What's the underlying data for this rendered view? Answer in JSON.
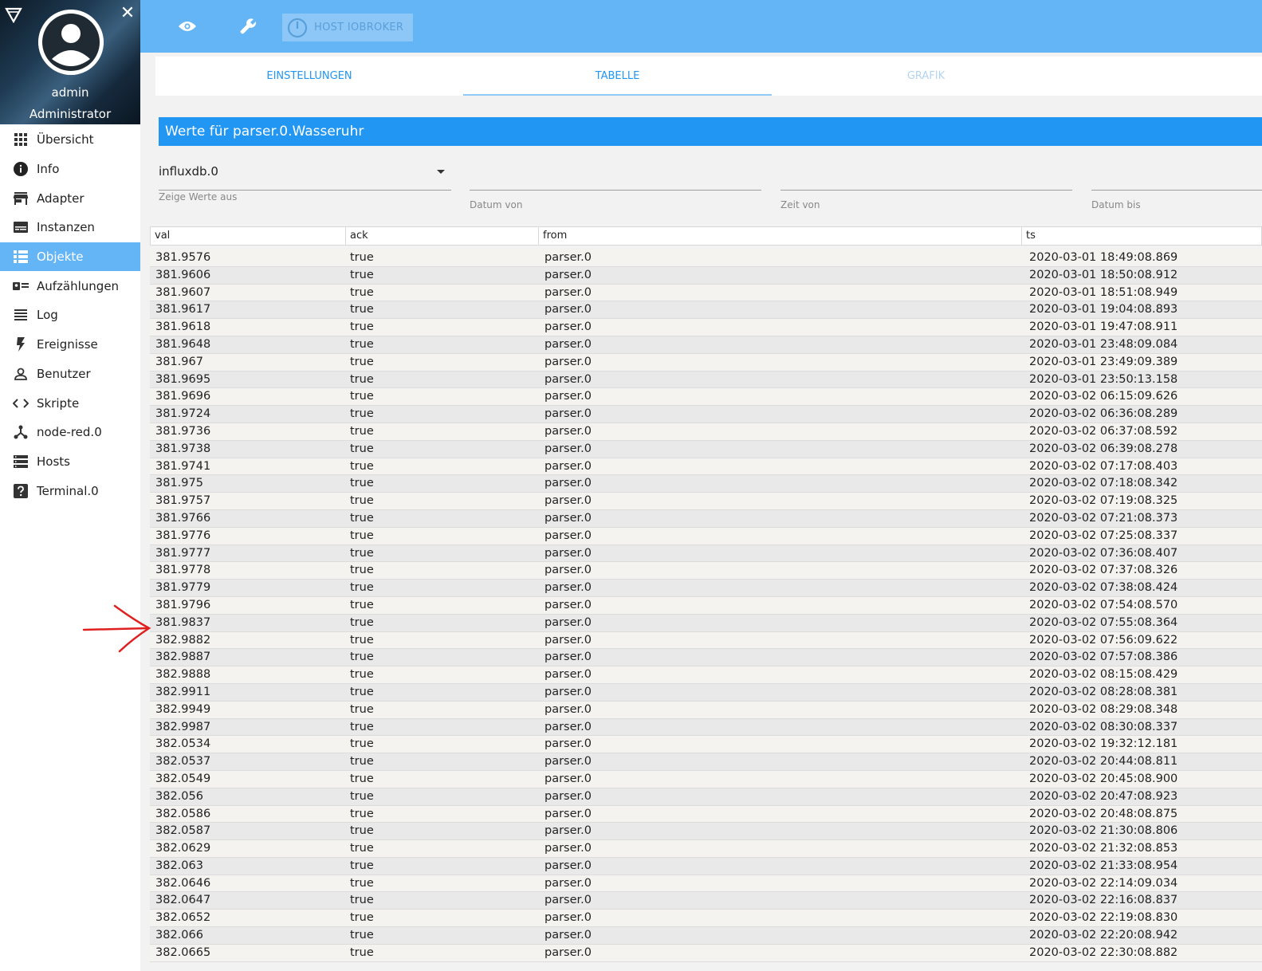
{
  "sidebar": {
    "user": {
      "name": "admin",
      "role": "Administrator"
    },
    "items": [
      {
        "label": "Übersicht",
        "icon": "apps-grid-icon",
        "active": false
      },
      {
        "label": "Info",
        "icon": "info-icon",
        "active": false
      },
      {
        "label": "Adapter",
        "icon": "store-icon",
        "active": false
      },
      {
        "label": "Instanzen",
        "icon": "instances-icon",
        "active": false
      },
      {
        "label": "Objekte",
        "icon": "list-icon",
        "active": true
      },
      {
        "label": "Aufzählungen",
        "icon": "enum-icon",
        "active": false
      },
      {
        "label": "Log",
        "icon": "log-lines-icon",
        "active": false
      },
      {
        "label": "Ereignisse",
        "icon": "lightning-icon",
        "active": false
      },
      {
        "label": "Benutzer",
        "icon": "user-icon",
        "active": false
      },
      {
        "label": "Skripte",
        "icon": "code-icon",
        "active": false
      },
      {
        "label": "node-red.0",
        "icon": "node-red-icon",
        "active": false
      },
      {
        "label": "Hosts",
        "icon": "hosts-icon",
        "active": false
      },
      {
        "label": "Terminal.0",
        "icon": "help-box-icon",
        "active": false
      }
    ]
  },
  "topbar": {
    "host_button": "HOST IOBROKER"
  },
  "tabs": [
    {
      "label": "EINSTELLUNGEN",
      "state": "normal"
    },
    {
      "label": "TABELLE",
      "state": "active"
    },
    {
      "label": "GRAFIK",
      "state": "disabled"
    }
  ],
  "panel": {
    "title": "Werte für parser.0.Wasseruhr",
    "instance_select": {
      "value": "influxdb.0",
      "label": "Zeige Werte aus"
    },
    "date_from_label": "Datum von",
    "time_from_label": "Zeit von",
    "date_to_label": "Datum bis"
  },
  "table": {
    "columns": [
      "val",
      "ack",
      "from",
      "ts"
    ],
    "rows": [
      [
        "381.9576",
        "true",
        "parser.0",
        "2020-03-01 18:49:08.869"
      ],
      [
        "381.9606",
        "true",
        "parser.0",
        "2020-03-01 18:50:08.912"
      ],
      [
        "381.9607",
        "true",
        "parser.0",
        "2020-03-01 18:51:08.949"
      ],
      [
        "381.9617",
        "true",
        "parser.0",
        "2020-03-01 19:04:08.893"
      ],
      [
        "381.9618",
        "true",
        "parser.0",
        "2020-03-01 19:47:08.911"
      ],
      [
        "381.9648",
        "true",
        "parser.0",
        "2020-03-01 23:48:09.084"
      ],
      [
        "381.967",
        "true",
        "parser.0",
        "2020-03-01 23:49:09.389"
      ],
      [
        "381.9695",
        "true",
        "parser.0",
        "2020-03-01 23:50:13.158"
      ],
      [
        "381.9696",
        "true",
        "parser.0",
        "2020-03-02 06:15:09.626"
      ],
      [
        "381.9724",
        "true",
        "parser.0",
        "2020-03-02 06:36:08.289"
      ],
      [
        "381.9736",
        "true",
        "parser.0",
        "2020-03-02 06:37:08.592"
      ],
      [
        "381.9738",
        "true",
        "parser.0",
        "2020-03-02 06:39:08.278"
      ],
      [
        "381.9741",
        "true",
        "parser.0",
        "2020-03-02 07:17:08.403"
      ],
      [
        "381.975",
        "true",
        "parser.0",
        "2020-03-02 07:18:08.342"
      ],
      [
        "381.9757",
        "true",
        "parser.0",
        "2020-03-02 07:19:08.325"
      ],
      [
        "381.9766",
        "true",
        "parser.0",
        "2020-03-02 07:21:08.373"
      ],
      [
        "381.9776",
        "true",
        "parser.0",
        "2020-03-02 07:25:08.337"
      ],
      [
        "381.9777",
        "true",
        "parser.0",
        "2020-03-02 07:36:08.407"
      ],
      [
        "381.9778",
        "true",
        "parser.0",
        "2020-03-02 07:37:08.326"
      ],
      [
        "381.9779",
        "true",
        "parser.0",
        "2020-03-02 07:38:08.424"
      ],
      [
        "381.9796",
        "true",
        "parser.0",
        "2020-03-02 07:54:08.570"
      ],
      [
        "381.9837",
        "true",
        "parser.0",
        "2020-03-02 07:55:08.364"
      ],
      [
        "382.9882",
        "true",
        "parser.0",
        "2020-03-02 07:56:09.622"
      ],
      [
        "382.9887",
        "true",
        "parser.0",
        "2020-03-02 07:57:08.386"
      ],
      [
        "382.9888",
        "true",
        "parser.0",
        "2020-03-02 08:15:08.429"
      ],
      [
        "382.9911",
        "true",
        "parser.0",
        "2020-03-02 08:28:08.381"
      ],
      [
        "382.9949",
        "true",
        "parser.0",
        "2020-03-02 08:29:08.348"
      ],
      [
        "382.9987",
        "true",
        "parser.0",
        "2020-03-02 08:30:08.337"
      ],
      [
        "382.0534",
        "true",
        "parser.0",
        "2020-03-02 19:32:12.181"
      ],
      [
        "382.0537",
        "true",
        "parser.0",
        "2020-03-02 20:44:08.811"
      ],
      [
        "382.0549",
        "true",
        "parser.0",
        "2020-03-02 20:45:08.900"
      ],
      [
        "382.056",
        "true",
        "parser.0",
        "2020-03-02 20:47:08.923"
      ],
      [
        "382.0586",
        "true",
        "parser.0",
        "2020-03-02 20:48:08.875"
      ],
      [
        "382.0587",
        "true",
        "parser.0",
        "2020-03-02 21:30:08.806"
      ],
      [
        "382.0629",
        "true",
        "parser.0",
        "2020-03-02 21:32:08.853"
      ],
      [
        "382.063",
        "true",
        "parser.0",
        "2020-03-02 21:33:08.954"
      ],
      [
        "382.0646",
        "true",
        "parser.0",
        "2020-03-02 22:14:09.034"
      ],
      [
        "382.0647",
        "true",
        "parser.0",
        "2020-03-02 22:16:08.837"
      ],
      [
        "382.0652",
        "true",
        "parser.0",
        "2020-03-02 22:19:08.830"
      ],
      [
        "382.066",
        "true",
        "parser.0",
        "2020-03-02 22:20:08.942"
      ],
      [
        "382.0665",
        "true",
        "parser.0",
        "2020-03-02 22:30:08.882"
      ]
    ]
  },
  "colors": {
    "topbar": "#64b5f6",
    "title_bar": "#2196f3",
    "active_nav": "#64b5f6",
    "annotation_arrow": "#e02020"
  }
}
